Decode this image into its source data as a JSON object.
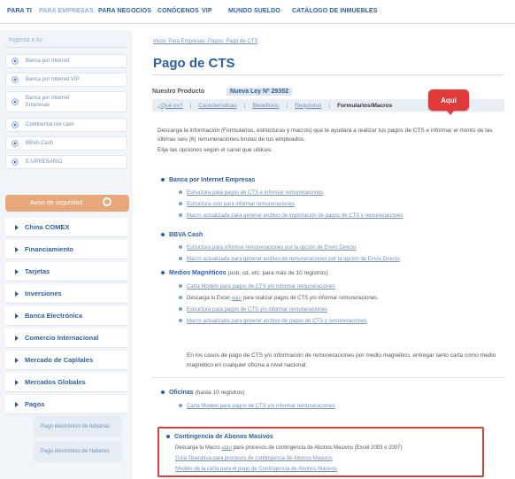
{
  "topnav": {
    "items": [
      "PARA TI",
      "PARA EMPRESAS",
      "PARA NEGOCIOS",
      "CONÓCENOS",
      "VIP",
      "MUNDO SUELDO",
      "CATÁLOGO DE INMUEBLES"
    ],
    "active_index": 1
  },
  "sidebar": {
    "title": "Ingresa a tu:",
    "links": [
      "Banca por Internet",
      "Banca por Internet VIP",
      "Banca por Internet Empresas",
      "Continental net cash",
      "BBVA Cash",
      "E-UPRESARIO"
    ],
    "security_label": "Aviso de seguridad",
    "menu": [
      "China COMEX",
      "Financiamiento",
      "Tarjetas",
      "Inversiones",
      "Banca Electrónica",
      "Comercio Internacional",
      "Mercado de Capitales",
      "Mercados Globales",
      "Pagos"
    ],
    "submenu": [
      "Pago electrónico de Aduanas",
      "Pago electrónico de Haberes"
    ]
  },
  "breadcrumb": "Inicio: Para Empresas: Pagos: Pago de CTS",
  "page_title": "Pago de CTS",
  "nuevo": {
    "label": "Nuestro Producto",
    "badge": "Nueva Ley Nº 29352"
  },
  "tabs": [
    "¿Qué es?",
    "Características",
    "Beneficios",
    "Requisitos",
    "Formularios/Macros"
  ],
  "callout": "Aqui",
  "intro": [
    "Descarga la información (Formularios, estructuras y macros) que le ayudará a realizar tus pagos de CTS e informar el monto de las últimas seis (6) remuneraciones brutas de tus empleados.",
    "Elije las opciones según el canal que utilices."
  ],
  "sections": {
    "banca": {
      "title": "Banca por Internet Empresas",
      "items": [
        "Estructura para pagos de CTS e informar remuneraciones",
        "Estructura sólo para informar remuneraciones",
        "Macro actualizada para generar archivo de importación de pagos de CTS y remuneraciones"
      ]
    },
    "bbva": {
      "title": "BBVA Cash",
      "items": [
        "Estructura para informar remuneraciones por la opción de Envío Directo",
        "Macro actualizada para generar archivo de remuneraciones por la opción de Envío Directo"
      ]
    },
    "medios": {
      "title": "Medios Magnéticos",
      "note": "(usb, cd, etc. para más de 10 registros)",
      "items": [
        {
          "text": "Carta Modelo para pagos de CTS y/o informar remuneraciones",
          "link": true
        },
        {
          "pre": "Descarga tu Excel ",
          "link_text": "aquí",
          "post": " para realizar pagos de CTS y/o informar remuneraciones."
        },
        {
          "text": "Estructura para pagos de CTS y/o informar remuneraciones",
          "link": true
        },
        {
          "text": "Macro actualizada para generar archivo de pagos de CTS y remuneraciones",
          "link": true
        }
      ],
      "footnote": "En los casos de pago de CTS y/o información de remuneraciones por medio magnético, entregar tanto carta como medio magnético en cualquier oficina a nivel nacional."
    },
    "oficinas": {
      "title": "Oficinas",
      "note": "(hasta 10 registros)",
      "items": [
        "Carta Modelo para pagos de CTS y/o informar remuneraciones"
      ]
    },
    "contingencia": {
      "title": "Contingencia de Abonos Masivos",
      "line1_pre": "Descarga tu Macro ",
      "line1_link": "aquí",
      "line1_post": " para procesos de contingencia de Abonos Masivos (Excel 2003 o 2007)",
      "links": [
        "Guía Operativa para procesos de contingencia de Abonos Masivos",
        "Modelo de la carta para el pago de Contingencia de Abonos Masivos"
      ]
    }
  },
  "colors": {
    "brand": "#2d5fa6",
    "link": "#6f8fbf",
    "callout": "#e13a3a",
    "security": "#e8a77a"
  }
}
